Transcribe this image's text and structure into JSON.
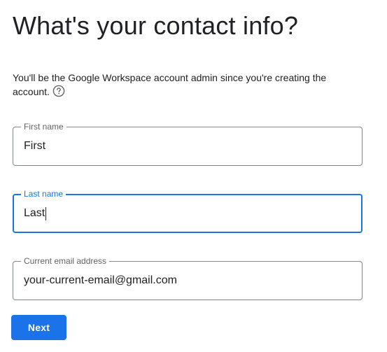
{
  "page": {
    "title": "What's your contact info?",
    "description": "You'll be the Google Workspace account admin since you're creating the account."
  },
  "form": {
    "first_name": {
      "label": "First name",
      "value": "First"
    },
    "last_name": {
      "label": "Last name",
      "value": "Last"
    },
    "email": {
      "label": "Current email address",
      "value": "your-current-email@gmail.com"
    }
  },
  "actions": {
    "next_label": "Next"
  },
  "colors": {
    "accent": "#1a73e8",
    "border": "#80868b",
    "text": "#202124",
    "label": "#5f6368"
  },
  "icons": {
    "help": "help-circle-icon"
  }
}
